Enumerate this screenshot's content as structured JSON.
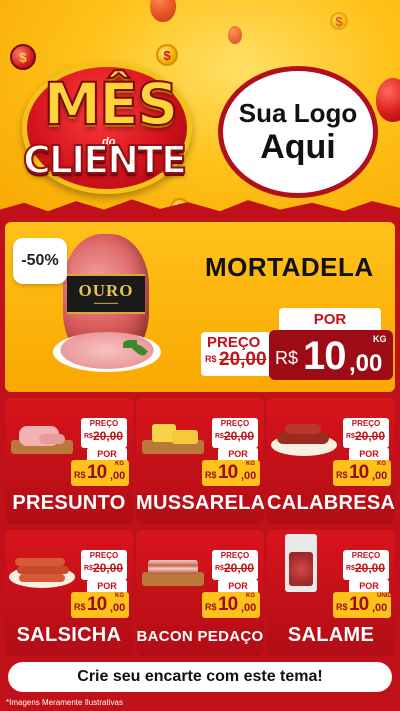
{
  "header": {
    "title_top": "MÊS",
    "title_small": "do",
    "title_bottom": "CLIENTE",
    "logo_line1": "Sua Logo",
    "logo_line2": "Aqui",
    "coin_symbol": "$"
  },
  "featured": {
    "discount": "-50%",
    "product_brand": "OURO",
    "name": "MORTADELA",
    "preco_label": "PREÇO",
    "old_currency": "R$",
    "old_price": "20,00",
    "por_label": "POR",
    "currency": "R$",
    "price_int": "10",
    "price_dec": ",00",
    "unit": "KG"
  },
  "products": [
    {
      "name": "PRESUNTO",
      "preco_label": "PREÇO",
      "old_currency": "R$",
      "old_price": "20,00",
      "por_label": "POR",
      "currency": "R$",
      "price_int": "10",
      "price_dec": ",00",
      "unit": "KG"
    },
    {
      "name": "MUSSARELA",
      "preco_label": "PREÇO",
      "old_currency": "R$",
      "old_price": "20,00",
      "por_label": "POR",
      "currency": "R$",
      "price_int": "10",
      "price_dec": ",00",
      "unit": "KG"
    },
    {
      "name": "CALABRESA",
      "preco_label": "PREÇO",
      "old_currency": "R$",
      "old_price": "20,00",
      "por_label": "POR",
      "currency": "R$",
      "price_int": "10",
      "price_dec": ",00",
      "unit": "KG"
    },
    {
      "name": "SALSICHA",
      "preco_label": "PREÇO",
      "old_currency": "R$",
      "old_price": "20,00",
      "por_label": "POR",
      "currency": "R$",
      "price_int": "10",
      "price_dec": ",00",
      "unit": "KG"
    },
    {
      "name": "BACON PEDAÇO",
      "preco_label": "PREÇO",
      "old_currency": "R$",
      "old_price": "20,00",
      "por_label": "POR",
      "currency": "R$",
      "price_int": "10",
      "price_dec": ",00",
      "unit": "KG"
    },
    {
      "name": "SALAME",
      "preco_label": "PREÇO",
      "old_currency": "R$",
      "old_price": "20,00",
      "por_label": "POR",
      "currency": "R$",
      "price_int": "10",
      "price_dec": ",00",
      "unit": "UNID"
    }
  ],
  "footer": {
    "cta": "Crie seu encarte com este tema!",
    "disclaimer": "*Imagens Meramente Ilustrativas"
  },
  "colors": {
    "background_red": "#c0111a",
    "accent_yellow": "#ffc21a",
    "price_dark_red": "#9d0c14"
  }
}
